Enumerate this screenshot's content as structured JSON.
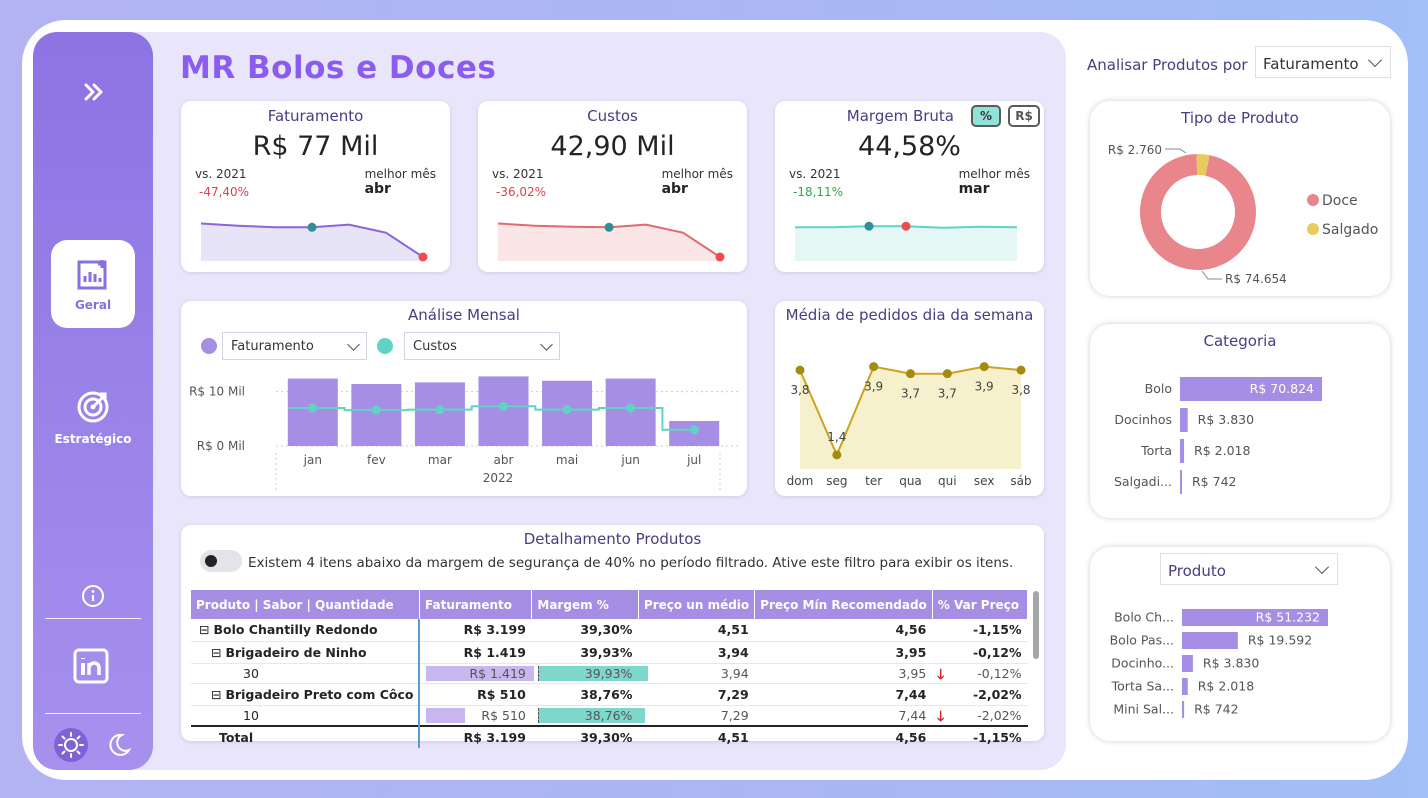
{
  "title": "MR Bolos e Doces",
  "sidebar": {
    "nav": [
      {
        "label": "Geral"
      },
      {
        "label": "Estratégico"
      }
    ]
  },
  "kpis": [
    {
      "title": "Faturamento",
      "value": "R$ 77 Mil",
      "vs": "vs. 2021",
      "var": "-47,40%",
      "var_color": "#d64550",
      "best_label": "melhor mês",
      "best": "abr",
      "line_color": "#8a66d8",
      "fill": "#e8e4f8",
      "series": [
        0.62,
        0.58,
        0.55,
        0.55,
        0.6,
        0.45,
        0.0
      ]
    },
    {
      "title": "Custos",
      "value": "42,90 Mil",
      "vs": "vs. 2021",
      "var": "-36,02%",
      "var_color": "#d64550",
      "best_label": "melhor mês",
      "best": "abr",
      "line_color": "#e06a6f",
      "fill": "#fbe6e7",
      "series": [
        0.62,
        0.58,
        0.56,
        0.55,
        0.6,
        0.45,
        0.0
      ]
    },
    {
      "title": "Margem Bruta",
      "value": "44,58%",
      "vs": "vs. 2021",
      "var": "-18,11%",
      "var_color": "#2faa4f",
      "best_label": "melhor mês",
      "best": "mar",
      "line_color": "#61d3c6",
      "fill": "#e5f7f5",
      "series": [
        0.55,
        0.55,
        0.57,
        0.57,
        0.54,
        0.56,
        0.55
      ],
      "toggle_pct": "%",
      "toggle_rs": "R$"
    }
  ],
  "analise_mensal": {
    "title": "Análise Mensal",
    "dd1": "Faturamento",
    "dd2": "Custos",
    "bar_color": "#a58ee4",
    "line_color": "#61d3c6",
    "y_ticks": [
      "R$ 10 Mil",
      "R$ 0 Mil"
    ],
    "year": "2022",
    "chart_data": {
      "type": "bar",
      "categories": [
        "jan",
        "fev",
        "mar",
        "abr",
        "mai",
        "jun",
        "jul"
      ],
      "series": [
        {
          "name": "Faturamento",
          "values": [
            12.4,
            11.4,
            11.7,
            12.8,
            12.0,
            12.4,
            4.6
          ]
        },
        {
          "name": "Custos",
          "values": [
            7.0,
            6.6,
            6.7,
            7.3,
            6.7,
            7.0,
            3.0
          ]
        }
      ],
      "ylim": [
        0,
        20
      ]
    }
  },
  "media_pedidos": {
    "title": "Média de pedidos dia da semana",
    "color": "#c9a520",
    "fill": "#f7f0cc",
    "chart_data": {
      "type": "area",
      "x": [
        "dom",
        "seg",
        "ter",
        "qua",
        "qui",
        "sex",
        "sáb"
      ],
      "values": [
        3.8,
        1.4,
        3.9,
        3.7,
        3.7,
        3.9,
        3.8
      ],
      "labels": [
        "3,8",
        "1,4",
        "3,9",
        "3,7",
        "3,7",
        "3,9",
        "3,8"
      ],
      "ylim": [
        1.0,
        4.2
      ]
    }
  },
  "detalhamento": {
    "title": "Detalhamento Produtos",
    "toggle_text": "Existem 4 itens abaixo da margem de segurança de 40% no período filtrado. Ative este filtro para exibir os itens.",
    "columns": [
      "Produto | Sabor | Quantidade",
      "Faturamento",
      "Margem %",
      "Preço un médio",
      "Preço Mín Recomendado",
      "% Var Preço"
    ],
    "rows": [
      {
        "level": 0,
        "expand": "⊟",
        "name": "Bolo Chantilly Redondo",
        "fat": "R$ 3.199",
        "marg": "39,30%",
        "preco": "4,51",
        "min": "4,56",
        "var": "-1,15%",
        "bold": true
      },
      {
        "level": 1,
        "expand": "⊟",
        "name": "Brigadeiro de Ninho",
        "fat": "R$ 1.419",
        "marg": "39,93%",
        "preco": "3,94",
        "min": "3,95",
        "var": "-0,12%",
        "bold": true
      },
      {
        "level": 2,
        "expand": "",
        "name": "30",
        "fat": "R$ 1.419",
        "marg": "39,93%",
        "preco": "3,94",
        "min": "3,95",
        "var": "-0,12%",
        "bold": false,
        "bar_fat": 1.0,
        "bar_marg": 1.0,
        "arrow": true
      },
      {
        "level": 1,
        "expand": "⊟",
        "name": "Brigadeiro Preto com Côco",
        "fat": "R$ 510",
        "marg": "38,76%",
        "preco": "7,29",
        "min": "7,44",
        "var": "-2,02%",
        "bold": true
      },
      {
        "level": 2,
        "expand": "",
        "name": "10",
        "fat": "R$ 510",
        "marg": "38,76%",
        "preco": "7,29",
        "min": "7,44",
        "var": "-2,02%",
        "bold": false,
        "bar_fat": 0.36,
        "bar_marg": 0.97,
        "arrow": true
      }
    ],
    "total": {
      "name": "Total",
      "fat": "R$ 3.199",
      "marg": "39,30%",
      "preco": "4,51",
      "min": "4,56",
      "var": "-1,15%"
    }
  },
  "right_panel": {
    "label": "Analisar Produtos por",
    "dropdown": "Faturamento",
    "tipo": {
      "title": "Tipo de Produto",
      "chart_data": {
        "type": "pie",
        "categories": [
          "Doce",
          "Salgado"
        ],
        "values": [
          74654,
          2760
        ],
        "labels": [
          "R$ 74.654",
          "R$ 2.760"
        ],
        "colors": [
          "#e8868c",
          "#e9cb5c"
        ]
      }
    },
    "categoria": {
      "title": "Categoria",
      "bar_color": "#a58ee4",
      "chart_data": {
        "type": "bar",
        "categories": [
          "Bolo",
          "Docinhos",
          "Torta",
          "Salgadi..."
        ],
        "values": [
          70824,
          3830,
          2018,
          742
        ],
        "labels": [
          "R$ 70.824",
          "R$ 3.830",
          "R$ 2.018",
          "R$ 742"
        ]
      }
    },
    "produto": {
      "dropdown": "Produto",
      "bar_color": "#a58ee4",
      "chart_data": {
        "type": "bar",
        "categories": [
          "Bolo Ch...",
          "Bolo Pas...",
          "Docinho...",
          "Torta Sa...",
          "Mini Sal..."
        ],
        "values": [
          51232,
          19592,
          3830,
          2018,
          742
        ],
        "labels": [
          "R$ 51.232",
          "R$ 19.592",
          "R$ 3.830",
          "R$ 2.018",
          "R$ 742"
        ]
      }
    }
  }
}
